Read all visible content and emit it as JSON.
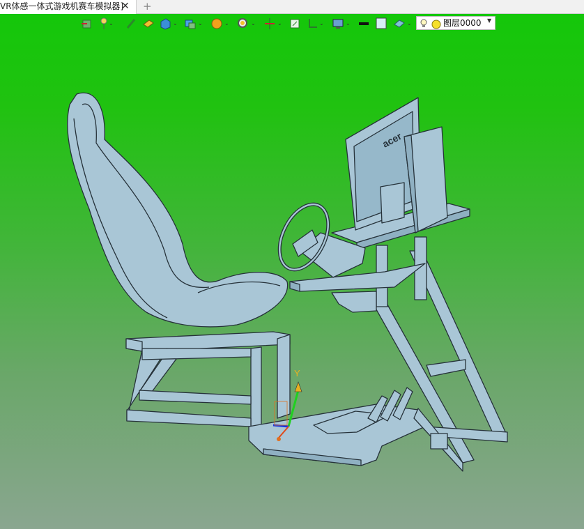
{
  "tab": {
    "title": "VR体感一体式游戏机赛车模拟器]",
    "close_glyph": "✕",
    "new_glyph": "+"
  },
  "toolbar": {
    "icons": [
      "import-icon",
      "pin-icon",
      "pencil-icon",
      "eraser-icon",
      "cube-icon",
      "layers-icon",
      "sphere-icon",
      "zoom-icon",
      "axes-icon",
      "fit-view-icon",
      "align-icon",
      "display-icon",
      "line-color-icon",
      "fill-color-icon",
      "material-icon"
    ],
    "layer_label": "图层0000",
    "layer_icons": [
      "lightbulb-icon",
      "layer-color-dot-icon"
    ]
  },
  "viewport": {
    "background_top": "#14c70a",
    "background_bottom": "#8aa690",
    "model_fill": "#a9c6d6",
    "model_stroke": "#26323a",
    "axis_y_label": "Y",
    "axis_y_color": "#1fd11f",
    "axis_x_color": "#e04a1a",
    "axis_z_color": "#1a35e0",
    "model": "acer"
  }
}
